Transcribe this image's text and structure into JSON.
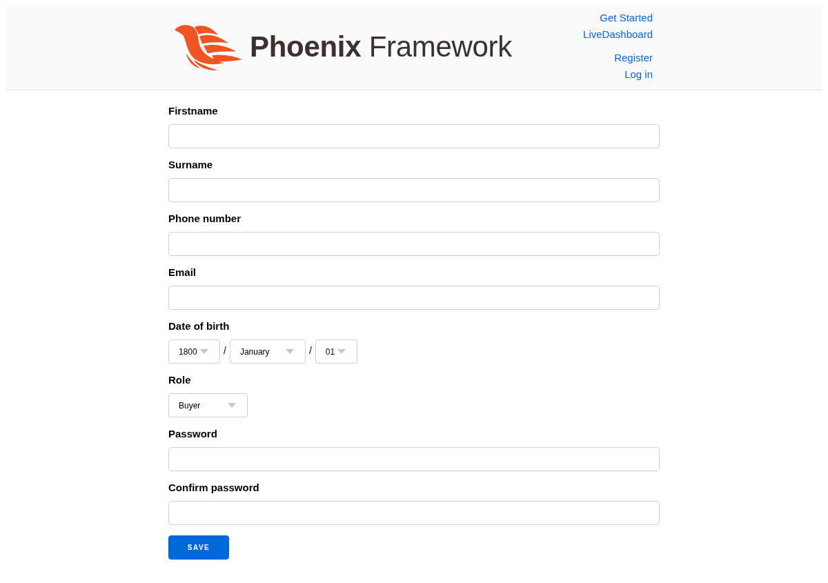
{
  "header": {
    "logo": {
      "text": "**Phoenix** Framework"
    },
    "nav": [
      {
        "label": "Get Started"
      },
      {
        "label": "LiveDashboard"
      }
    ],
    "user_menu": [
      {
        "label": "Register"
      },
      {
        "label": "Log in"
      }
    ]
  },
  "form": {
    "fields": [
      {
        "kind": "text",
        "label": "Firstname"
      },
      {
        "kind": "text",
        "label": "Surname"
      },
      {
        "kind": "text",
        "label": "Phone number"
      },
      {
        "kind": "text",
        "label": "Email"
      },
      {
        "kind": "date",
        "label": "Date of birth",
        "parts": [
          {
            "kind": "select",
            "value": "1800"
          },
          {
            "kind": "separator",
            "text": "/"
          },
          {
            "kind": "select",
            "value": "January"
          },
          {
            "kind": "separator",
            "text": "/"
          },
          {
            "kind": "select",
            "value": "01"
          }
        ]
      },
      {
        "kind": "select",
        "label": "Role",
        "value": "Buyer"
      },
      {
        "kind": "password",
        "label": "Password"
      },
      {
        "kind": "password",
        "label": "Confirm password"
      }
    ],
    "submit": "SAVE"
  }
}
